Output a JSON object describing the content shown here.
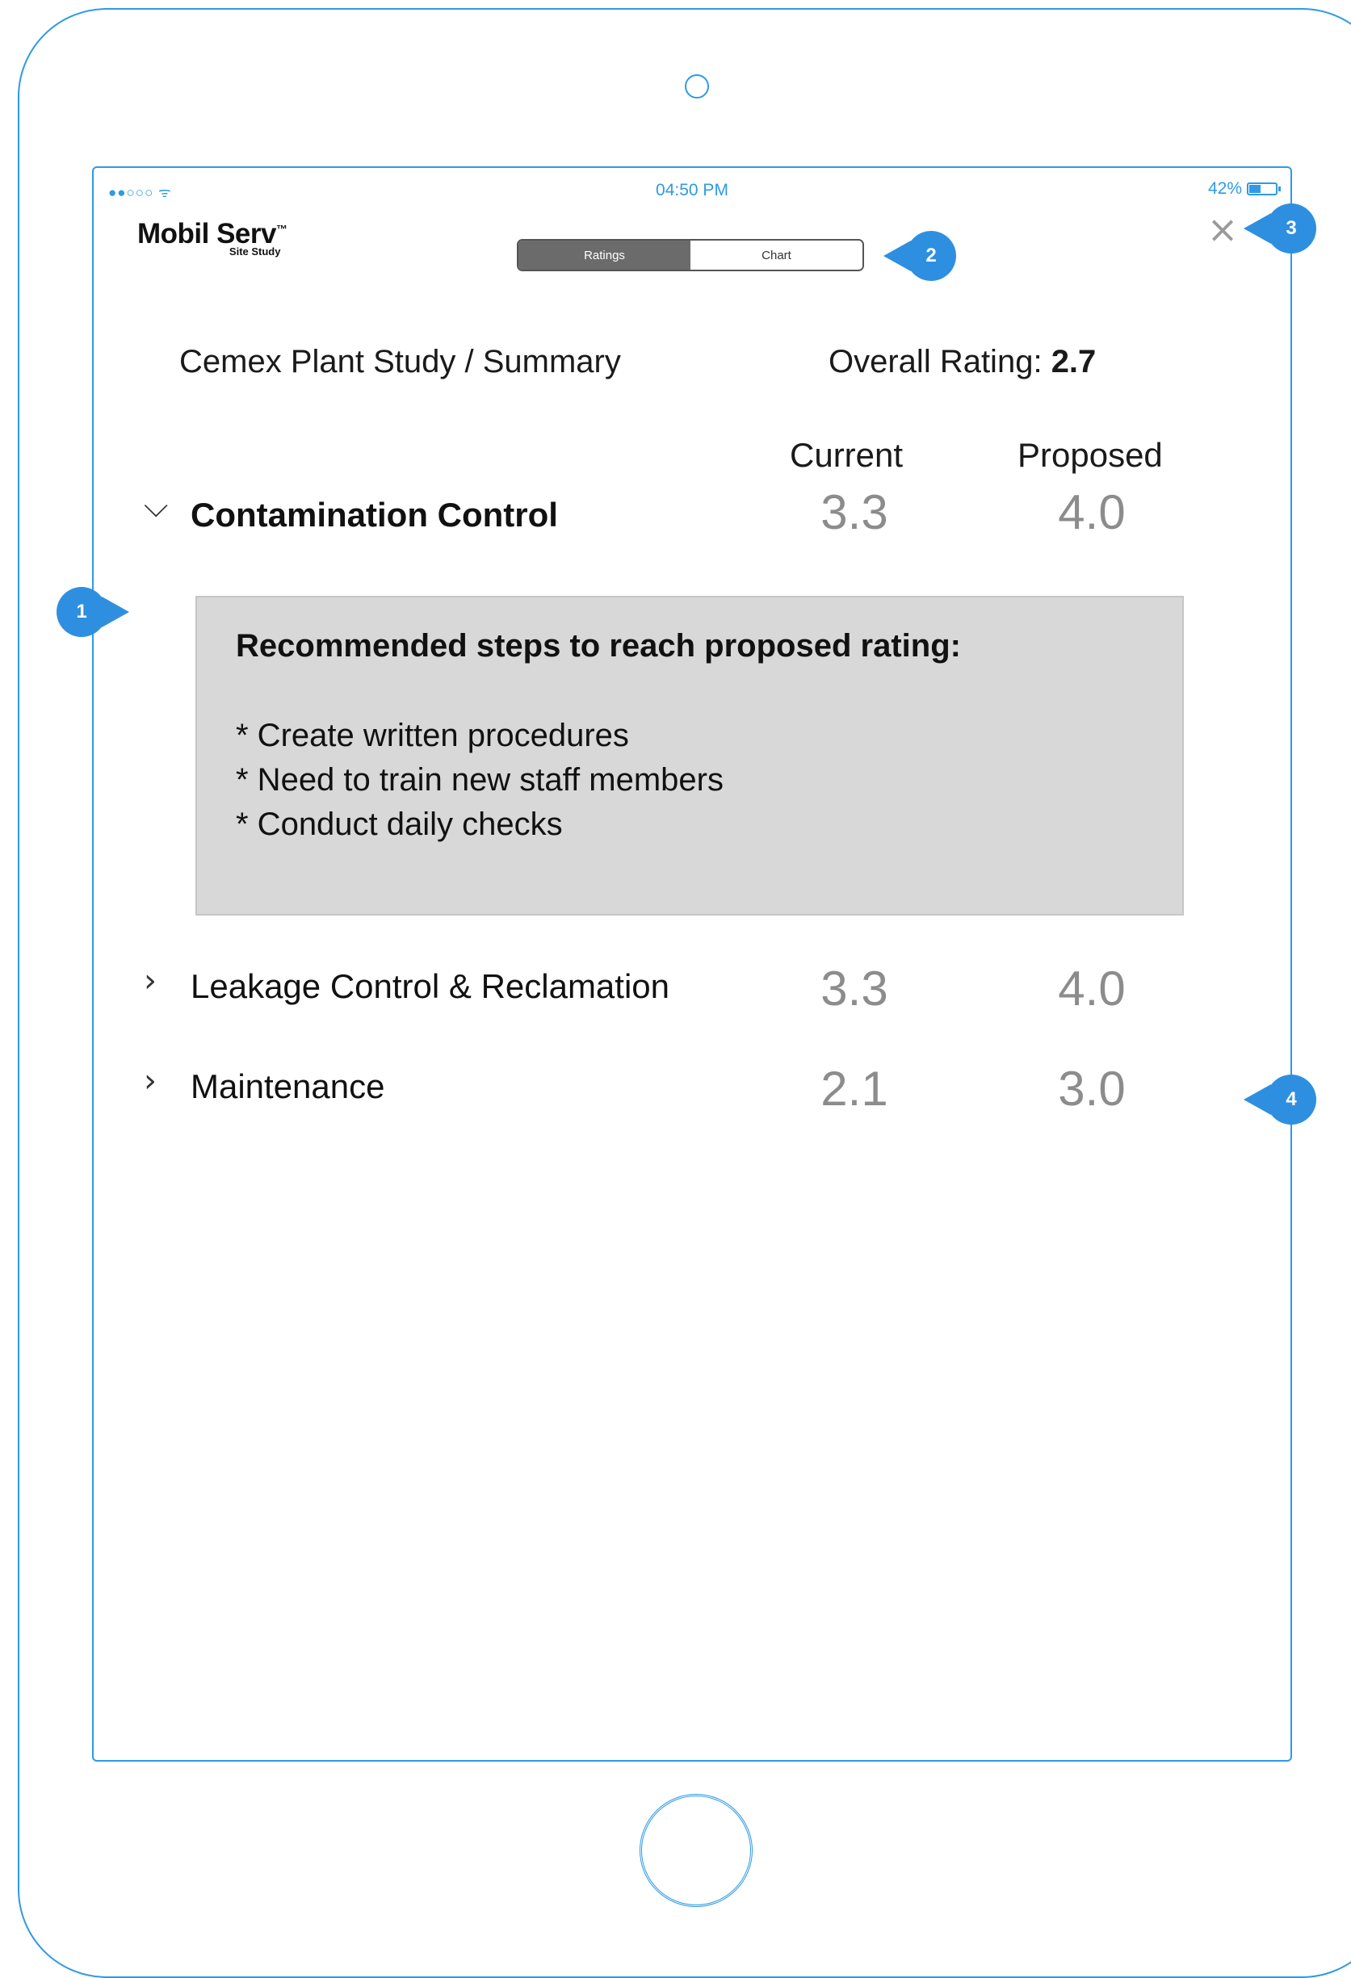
{
  "status_bar": {
    "signal": "●●○○○ ᯤ",
    "time": "04:50 PM",
    "battery_percent": "42%",
    "battery_level": 0.42
  },
  "logo": {
    "main": "Mobil Serv",
    "mark": "™",
    "sub": "Site Study"
  },
  "segmented": {
    "tabs": [
      {
        "label": "Ratings",
        "selected": true
      },
      {
        "label": "Chart",
        "selected": false
      }
    ]
  },
  "close_icon": "close-icon",
  "header": {
    "title": "Cemex Plant Study / Summary",
    "overall_label": "Overall Rating:",
    "overall_value": "2.7"
  },
  "columns": {
    "current": "Current",
    "proposed": "Proposed"
  },
  "categories": [
    {
      "name": "Contamination Control",
      "current": "3.3",
      "proposed": "4.0",
      "expanded": true
    },
    {
      "name": "Leakage Control & Reclamation",
      "current": "3.3",
      "proposed": "4.0",
      "expanded": false
    },
    {
      "name": "Maintenance",
      "current": "2.1",
      "proposed": "3.0",
      "expanded": false
    }
  ],
  "recommendation": {
    "title": "Recommended steps to reach proposed rating:",
    "steps": [
      "* Create written procedures",
      "* Need to train new staff members",
      "* Conduct daily checks"
    ]
  },
  "callouts": [
    "1",
    "2",
    "3",
    "4"
  ],
  "colors": {
    "wireframe_blue": "#2e9ae6",
    "callout_blue": "#2e8fe0",
    "active_segment": "#6b6b6b",
    "panel_gray": "#d8d8d8",
    "value_gray": "#8c8c8c"
  }
}
